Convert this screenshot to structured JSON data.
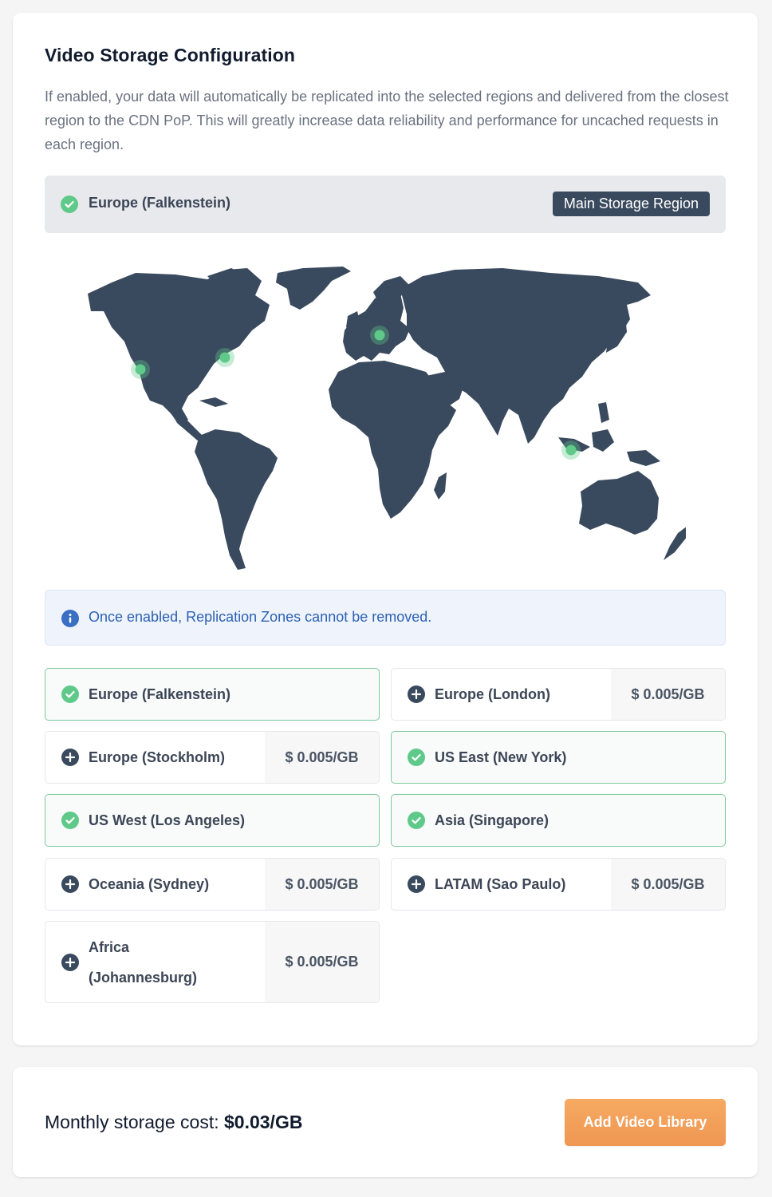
{
  "header": {
    "title": "Video Storage Configuration",
    "description": "If enabled, your data will automatically be replicated into the selected regions and delivered from the closest region to the CDN PoP. This will greatly increase data reliability and performance for uncached requests in each region."
  },
  "main_region": {
    "name": "Europe (Falkenstein)",
    "badge": "Main Storage Region",
    "icon": "check-circle-icon"
  },
  "map": {
    "land_color": "#3a4a5e",
    "marker_color": "#5fc98a",
    "markers": [
      "Europe (Falkenstein)",
      "US East (New York)",
      "US West (Los Angeles)",
      "Asia (Singapore)"
    ]
  },
  "notice": {
    "text": "Once enabled, Replication Zones cannot be removed.",
    "icon": "info-circle-icon"
  },
  "regions": [
    {
      "name": "Europe (Falkenstein)",
      "selected": true,
      "price": ""
    },
    {
      "name": "Europe (London)",
      "selected": false,
      "price": "$ 0.005/GB"
    },
    {
      "name": "Europe (Stockholm)",
      "selected": false,
      "price": "$ 0.005/GB"
    },
    {
      "name": "US East (New York)",
      "selected": true,
      "price": ""
    },
    {
      "name": "US West (Los Angeles)",
      "selected": true,
      "price": ""
    },
    {
      "name": "Asia (Singapore)",
      "selected": true,
      "price": ""
    },
    {
      "name": "Oceania (Sydney)",
      "selected": false,
      "price": "$ 0.005/GB"
    },
    {
      "name": "LATAM (Sao Paulo)",
      "selected": false,
      "price": "$ 0.005/GB"
    },
    {
      "name": "Africa",
      "name_line2": "(Johannesburg)",
      "selected": false,
      "price": "$ 0.005/GB"
    }
  ],
  "footer": {
    "cost_label": "Monthly storage cost:",
    "cost_value": "$0.03/GB",
    "add_button": "Add Video Library"
  },
  "colors": {
    "selected_border": "#7cc99b",
    "check": "#5fc98a",
    "accent_button": "#f29c58",
    "info_text": "#2e62b3"
  }
}
